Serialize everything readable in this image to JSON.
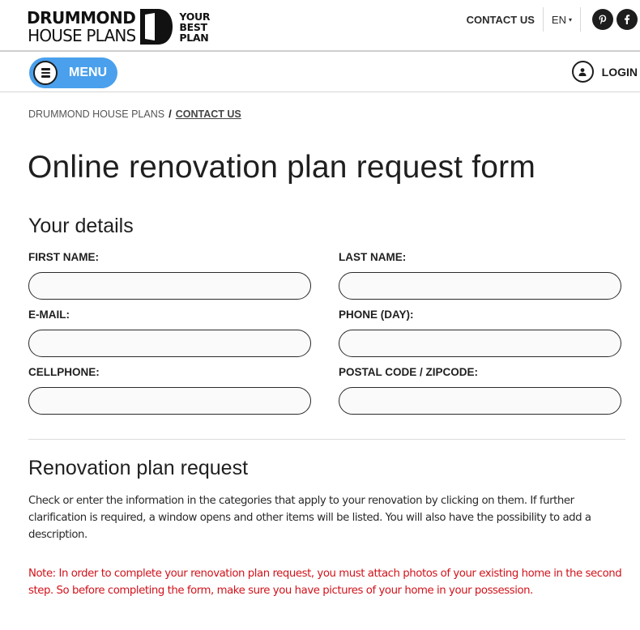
{
  "header": {
    "logo": {
      "line1": "DRUMMOND",
      "line2": "HOUSE PLANS",
      "tagline": [
        "YOUR",
        "BEST",
        "PLAN"
      ]
    },
    "nav": {
      "contact_label": "CONTACT US",
      "language_label": "EN",
      "language_caret": "▾",
      "social": [
        {
          "name": "pinterest",
          "icon": "pinterest-icon"
        },
        {
          "name": "facebook",
          "icon": "facebook-icon"
        }
      ]
    }
  },
  "menubar": {
    "menu_label": "MENU",
    "menu_icon": "hamburger-icon",
    "menu_color": "#4aa0ec",
    "login_label": "LOGIN",
    "login_icon": "user-icon"
  },
  "breadcrumb": {
    "items": [
      "DRUMMOND HOUSE PLANS",
      "CONTACT US"
    ],
    "separator": "/"
  },
  "page": {
    "title": "Online renovation plan request form"
  },
  "details": {
    "title": "Your details",
    "fields": [
      {
        "label": "FIRST NAME:",
        "value": "",
        "placeholder": ""
      },
      {
        "label": "LAST NAME:",
        "value": "",
        "placeholder": ""
      },
      {
        "label": "E-MAIL:",
        "value": "",
        "placeholder": ""
      },
      {
        "label": "PHONE (DAY):",
        "value": "",
        "placeholder": ""
      },
      {
        "label": "CELLPHONE:",
        "value": "",
        "placeholder": ""
      },
      {
        "label": "POSTAL CODE / ZIPCODE:",
        "value": "",
        "placeholder": ""
      }
    ]
  },
  "renovation": {
    "title": "Renovation plan request",
    "intro": "Check or enter the information in the categories that apply to your renovation by clicking on them. If further clarification is required, a window opens and other items will be listed. You will also have the possibility to add a description.",
    "note": "Note: In order to complete your renovation plan request, you must attach photos of your existing home in the second step. So before completing the form, make sure you have pictures of your home in your possession.",
    "note_color": "#d0131b"
  }
}
